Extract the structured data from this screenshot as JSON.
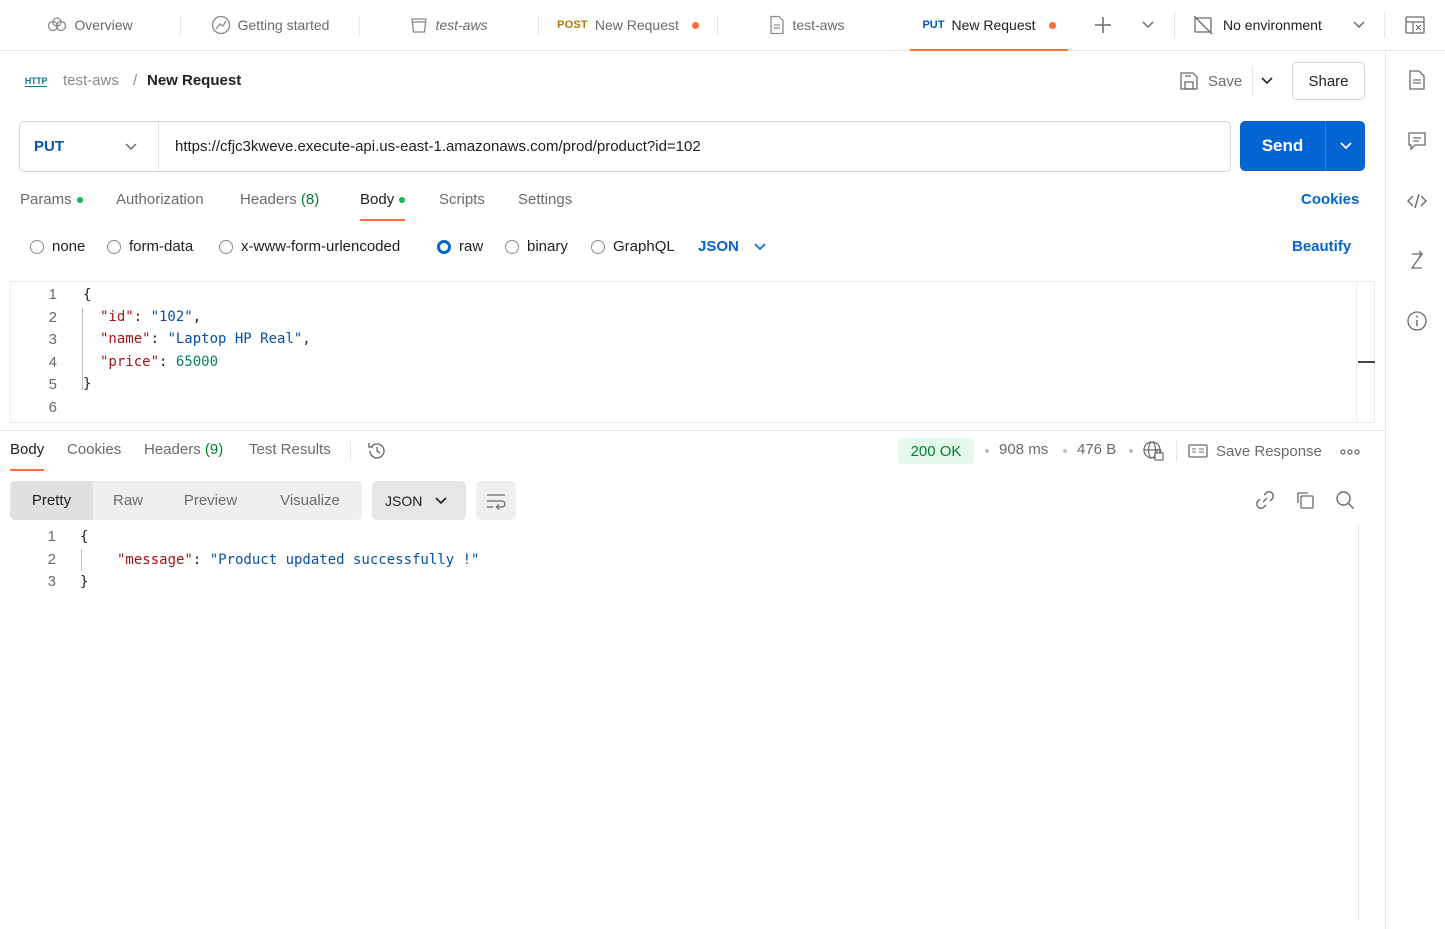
{
  "tabs": [
    {
      "label": "Overview",
      "icon": "overview-icon"
    },
    {
      "label": "Getting started",
      "icon": "getting-started-icon"
    },
    {
      "label": "test-aws",
      "icon": "collection-icon"
    },
    {
      "method": "POST",
      "label": "New Request",
      "unsaved": true
    },
    {
      "label": "test-aws",
      "icon": "document-icon"
    },
    {
      "method": "PUT",
      "label": "New Request",
      "unsaved": true,
      "active": true
    }
  ],
  "environment": {
    "label": "No environment"
  },
  "breadcrumb": {
    "badge": "HTTP",
    "collection": "test-aws",
    "separator": "/",
    "request": "New Request"
  },
  "header": {
    "save_label": "Save",
    "share_label": "Share"
  },
  "request": {
    "method": "PUT",
    "url": "https://cfjc3kweve.execute-api.us-east-1.amazonaws.com/prod/product?id=102",
    "send_label": "Send"
  },
  "request_tabs": {
    "params": "Params",
    "authorization": "Authorization",
    "headers": "Headers",
    "headers_count": "(8)",
    "body": "Body",
    "scripts": "Scripts",
    "settings": "Settings",
    "cookies": "Cookies"
  },
  "body_types": {
    "none": "none",
    "form_data": "form-data",
    "urlencoded": "x-www-form-urlencoded",
    "raw": "raw",
    "binary": "binary",
    "graphql": "GraphQL",
    "selected": "raw",
    "language": "JSON",
    "beautify": "Beautify"
  },
  "request_body": {
    "line_numbers": [
      "1",
      "2",
      "3",
      "4",
      "5",
      "6"
    ],
    "open": "{",
    "close": "}",
    "fields": [
      {
        "key": "\"id\"",
        "value": "\"102\"",
        "type": "string",
        "suffix": ","
      },
      {
        "key": "\"name\"",
        "value": "\"Laptop HP Real\"",
        "type": "string",
        "suffix": ","
      },
      {
        "key": "\"price\"",
        "value": "65000",
        "type": "number",
        "suffix": ""
      }
    ]
  },
  "response_tabs": {
    "body": "Body",
    "cookies": "Cookies",
    "headers": "Headers",
    "headers_count": "(9)",
    "test_results": "Test Results"
  },
  "response_status": {
    "status": "200 OK",
    "time": "908 ms",
    "size": "476 B",
    "save_response": "Save Response",
    "status_color": "#007f31"
  },
  "response_view": {
    "pretty": "Pretty",
    "raw": "Raw",
    "preview": "Preview",
    "visualize": "Visualize",
    "format": "JSON"
  },
  "response_body": {
    "line_numbers": [
      "1",
      "2",
      "3"
    ],
    "open": "{",
    "close": "}",
    "key": "\"message\"",
    "value": "\"Product updated successfully !\""
  },
  "colors": {
    "accent": "#ff6c37",
    "send": "#0265d2",
    "method_put": "#0053b8",
    "method_post": "#ad7a03"
  }
}
